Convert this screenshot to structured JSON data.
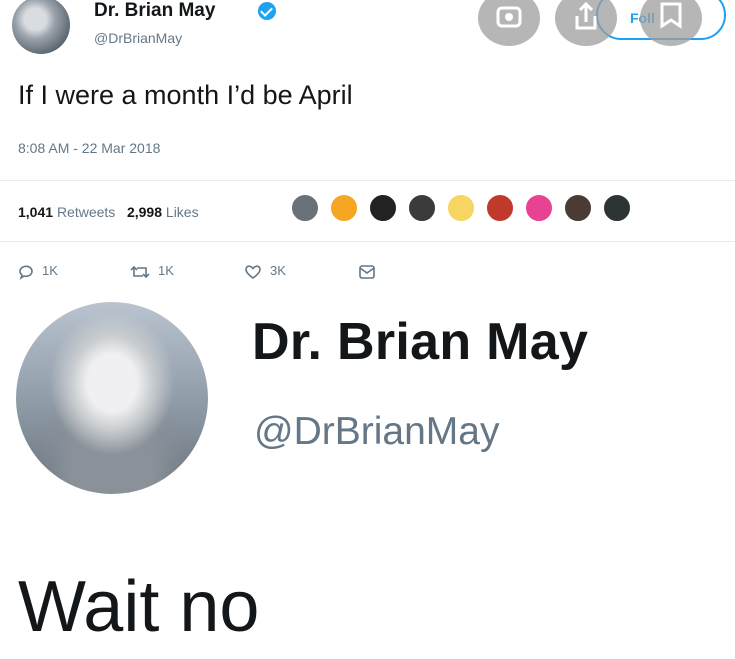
{
  "tweet": {
    "display_name": "Dr. Brian May",
    "handle": "@DrBrianMay",
    "follow_label": "Foll",
    "text": "If I were a month I’d be April",
    "timestamp": "8:08 AM - 22 Mar 2018",
    "retweets_count": "1,041",
    "retweets_label": "Retweets",
    "likes_count": "2,998",
    "likes_label": "Likes",
    "liker_avatars": [
      {
        "color": "#6b7178"
      },
      {
        "color": "#f5a623"
      },
      {
        "color": "#222222"
      },
      {
        "color": "#3b3b3b"
      },
      {
        "color": "#f7d560"
      },
      {
        "color": "#c0392b"
      },
      {
        "color": "#e84393"
      },
      {
        "color": "#4a3b35"
      },
      {
        "color": "#2d3436"
      }
    ],
    "actions": {
      "reply_count": "1K",
      "retweet_count": "1K",
      "like_count": "3K"
    }
  },
  "profile": {
    "display_name": "Dr. Brian May",
    "handle": "@DrBrianMay"
  },
  "caption": "Wait no",
  "icons": {
    "verified": "verified-badge-icon",
    "reply": "reply-icon",
    "retweet": "retweet-icon",
    "like": "heart-icon",
    "message": "message-icon",
    "lens": "lens-icon",
    "share": "share-icon"
  },
  "colors": {
    "accent": "#1da1f2",
    "secondary_text": "#657786"
  }
}
